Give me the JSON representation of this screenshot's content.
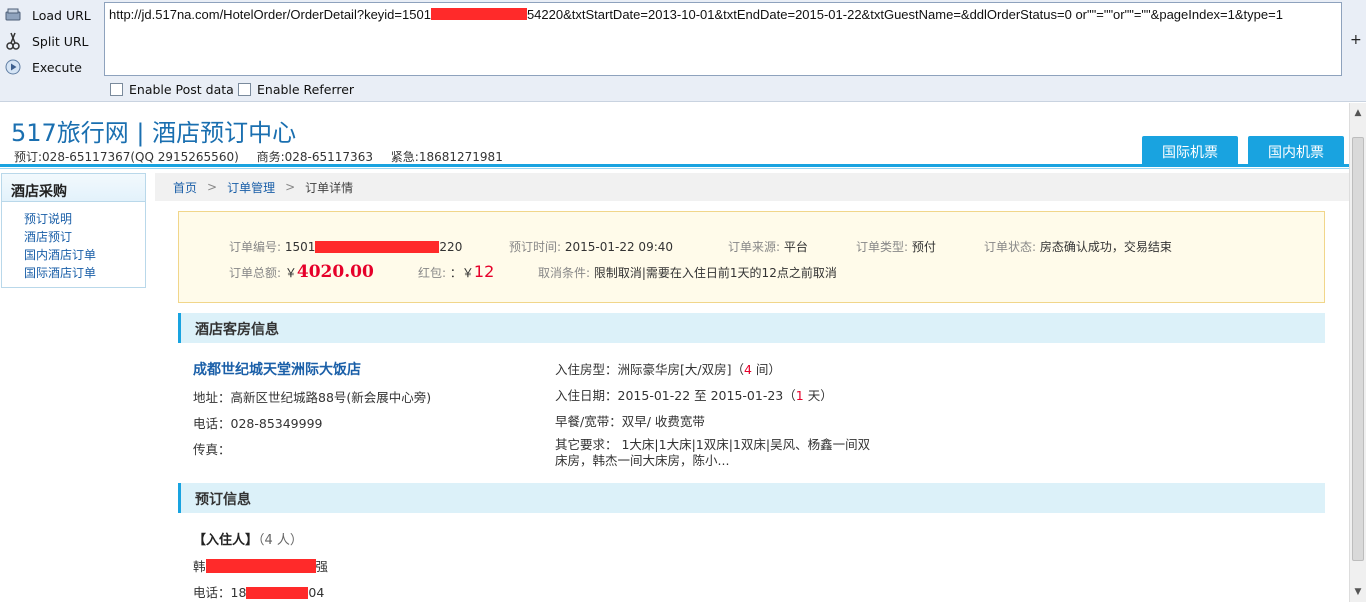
{
  "toolbar": {
    "load_label": "Load URL",
    "split_label": "Split URL",
    "execute_label": "Execute",
    "url_before": "http://jd.517na.com/HotelOrder/OrderDetail?keyid=1501",
    "url_after": "54220&txtStartDate=2013-10-01&txtEndDate=2015-01-22&txtGuestName=&ddlOrderStatus=0 or\"\"=\"\"or\"\"=\"\"&pageIndex=1&type=1",
    "url_scroll_symbol": "+",
    "post_label": "Enable Post data",
    "referrer_label": "Enable Referrer"
  },
  "header": {
    "brand": "517旅行网 | 酒店预订中心",
    "contact_booking": "预订:028-65117367(QQ 2915265560)",
    "contact_business": "商务:028-65117363",
    "contact_emergency": "紧急:18681271981",
    "tab_international": "国际机票",
    "tab_domestic": "国内机票"
  },
  "sidebar": {
    "title": "酒店采购",
    "items": [
      {
        "label": "预订说明"
      },
      {
        "label": "酒店预订"
      },
      {
        "label": "国内酒店订单"
      },
      {
        "label": "国际酒店订单"
      }
    ]
  },
  "breadcrumb": {
    "home": "首页",
    "orders": "订单管理",
    "current": "订单详情",
    "separator": ">"
  },
  "summary": {
    "order_no_label": "订单编号:",
    "order_no_prefix": "1501",
    "order_no_suffix": "220",
    "order_time_label": "预订时间:",
    "order_time": "2015-01-22 09:40",
    "source_label": "订单来源:",
    "source": "平台",
    "type_label": "订单类型:",
    "type": "预付",
    "status_label": "订单状态:",
    "status": "房态确认成功，交易结束",
    "total_label": "订单总额:",
    "total_currency": "￥",
    "total": "4020.00",
    "redpack_label": "红包:",
    "redpack_value": "：￥",
    "redpack": "12",
    "cancel_label": "取消条件:",
    "cancel": "限制取消|需要在入住日前1天的12点之前取消"
  },
  "hotel": {
    "section_title": "酒店客房信息",
    "name": "成都世纪城天堂洲际大饭店",
    "address": "地址：高新区世纪城路88号(新会展中心旁)",
    "phone": "电话：028-85349999",
    "fax": "传真：",
    "room_type_label": "入住房型：",
    "room_type": "洲际豪华房[大/双房]（",
    "room_count": "4",
    "room_unit": " 间）",
    "checkin_label": "入住日期：",
    "checkin_range": "2015-01-22 至 2015-01-23（",
    "nights": "1",
    "nights_unit": " 天）",
    "meal": "早餐/宽带：双早/ 收费宽带",
    "other_req": "其它要求： 1大床|1大床|1双床|1双床|吴风、杨鑫一间双床房，韩杰一间大床房，陈小..."
  },
  "booking": {
    "section_title": "预订信息",
    "guests_label": "【入住人】",
    "guests_count": "（4 人）",
    "guest_name_prefix": "韩",
    "guest_name_suffix": "强",
    "guest_phone_prefix": "电话：18",
    "guest_phone_suffix": "04"
  },
  "colors": {
    "accent": "#19a3e0",
    "link": "#1a5fa8",
    "price": "#e6002a",
    "redaction": "#ff2a2a"
  }
}
